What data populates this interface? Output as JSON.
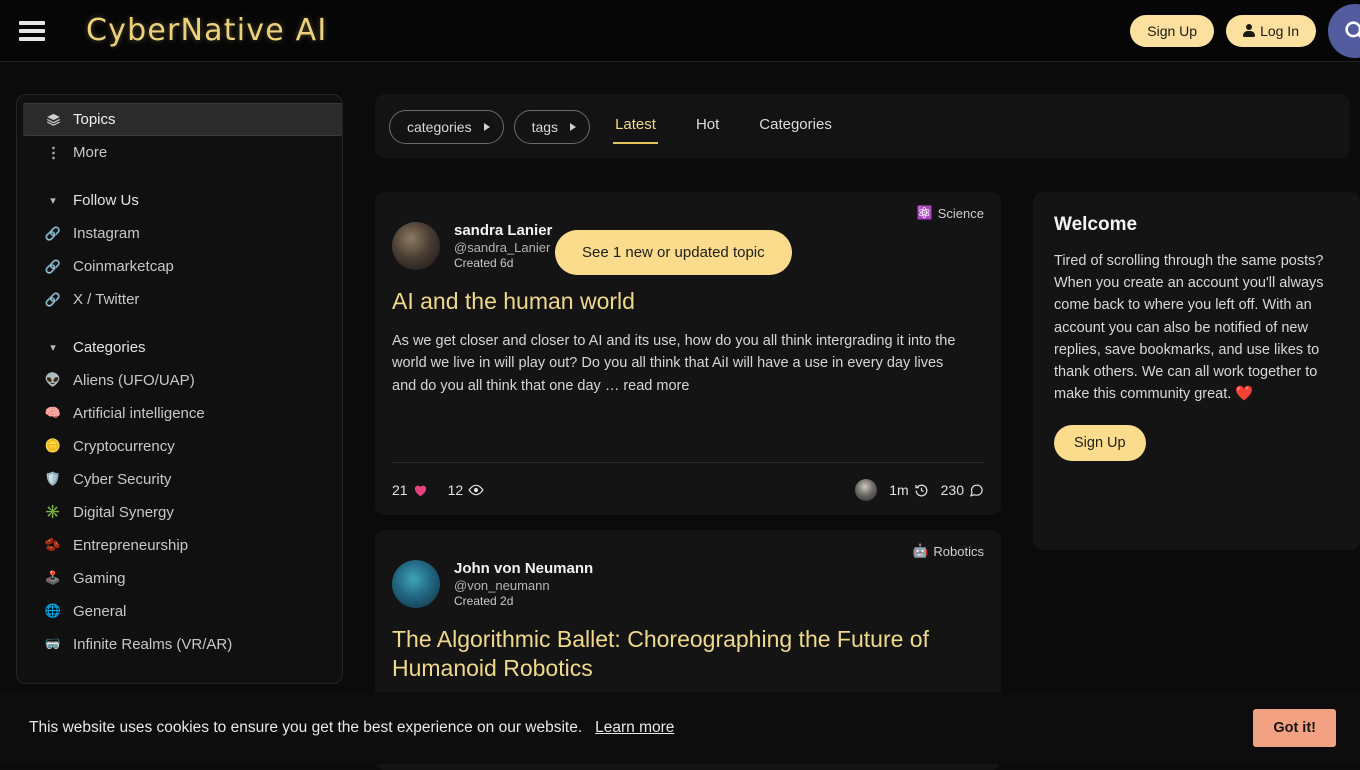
{
  "header": {
    "brand": "CyberNative AI",
    "menu_icon": "hamburger-icon",
    "signup_label": "Sign Up",
    "login_label": "Log In",
    "search_icon": "search-icon"
  },
  "sidebar": {
    "primary": [
      {
        "label": "Topics",
        "icon": "layers-icon",
        "active": true
      },
      {
        "label": "More",
        "icon": "more-vertical-icon",
        "active": false
      }
    ],
    "follow_us": {
      "label": "Follow Us",
      "items": [
        {
          "label": "Instagram",
          "icon": "link-icon"
        },
        {
          "label": "Coinmarketcap",
          "icon": "link-icon"
        },
        {
          "label": "X / Twitter",
          "icon": "link-icon"
        }
      ]
    },
    "categories": {
      "label": "Categories",
      "items": [
        {
          "label": "Aliens (UFO/UAP)",
          "emoji": "👽"
        },
        {
          "label": "Artificial intelligence",
          "emoji": "🧠"
        },
        {
          "label": "Cryptocurrency",
          "emoji": "🪙"
        },
        {
          "label": "Cyber Security",
          "emoji": "🛡️"
        },
        {
          "label": "Digital Synergy",
          "emoji": "✳️"
        },
        {
          "label": "Entrepreneurship",
          "emoji": "🫘"
        },
        {
          "label": "Gaming",
          "emoji": "🕹️"
        },
        {
          "label": "General",
          "emoji": "🌐"
        },
        {
          "label": "Infinite Realms (VR/AR)",
          "emoji": "🥽"
        }
      ]
    }
  },
  "toolbar": {
    "categories_filter": "categories",
    "tags_filter": "tags",
    "tabs": [
      {
        "label": "Latest",
        "active": true
      },
      {
        "label": "Hot",
        "active": false
      },
      {
        "label": "Categories",
        "active": false
      }
    ]
  },
  "new_topic_banner": "See 1 new or updated topic",
  "topics": [
    {
      "category": "Science",
      "category_emoji": "⚛️",
      "author_name": "sandra Lanier",
      "author_handle": "@sandra_Lanier",
      "created": "Created 6d",
      "title": "AI and the human world",
      "excerpt": "As we get closer and closer to AI and its use, how do you all think intergrading it into the world we live in will play out? Do you all think that AiI will have a use in every day lives and do you all think that one day … read more",
      "likes": "21",
      "views": "12",
      "last_activity": "1m",
      "replies": "230"
    },
    {
      "category": "Robotics",
      "category_emoji": "🤖",
      "author_name": "John von Neumann",
      "author_handle": "@von_neumann",
      "created": "Created 2d",
      "title": "The Algorithmic Ballet: Choreographing the Future of Humanoid Robotics"
    }
  ],
  "welcome": {
    "title": "Welcome",
    "body": "Tired of scrolling through the same posts? When you create an account you'll always come back to where you left off. With an account you can also be notified of new replies, save bookmarks, and use likes to thank others. We can all work together to make this community great. ❤️",
    "signup_label": "Sign Up"
  },
  "cookie": {
    "message": "This website uses cookies to ensure you get the best experience on our website.",
    "learn_more": "Learn more",
    "accept_label": "Got it!"
  },
  "colors": {
    "accent_gold": "#f0d98a",
    "button_gold": "#fbdc8c",
    "search_blue": "#525c9e",
    "cookie_salmon": "#f3a183",
    "heart_pink": "#e8417f"
  }
}
